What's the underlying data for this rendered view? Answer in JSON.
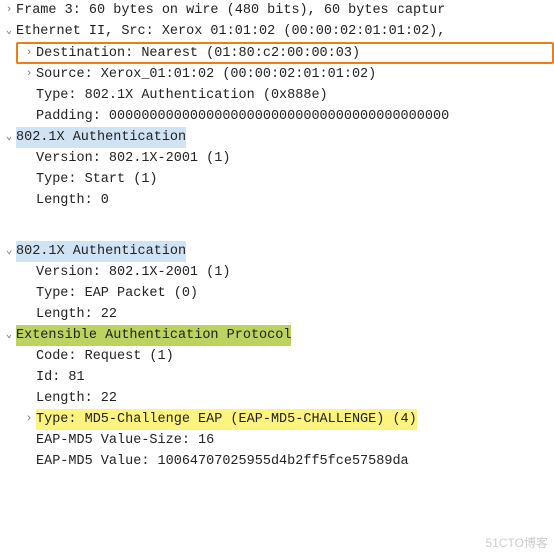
{
  "top": {
    "frame": "Frame 3: 60 bytes on wire (480 bits), 60 bytes captur",
    "eth": "Ethernet II, Src: Xerox 01:01:02 (00:00:02:01:01:02),",
    "dst": "Destination: Nearest (01:80:c2:00:00:03)",
    "src": "Source: Xerox_01:01:02 (00:00:02:01:01:02)",
    "type": "Type: 802.1X Authentication (0x888e)",
    "pad": "Padding: 000000000000000000000000000000000000000000",
    "auth": "802.1X Authentication",
    "ver": "Version: 802.1X-2001 (1)",
    "atype": "Type: Start (1)",
    "len": "Length: 0"
  },
  "bottom": {
    "auth": "802.1X Authentication",
    "ver": "Version: 802.1X-2001 (1)",
    "atype": "Type: EAP Packet (0)",
    "len": "Length: 22",
    "eap": "Extensible Authentication Protocol",
    "code": "Code: Request (1)",
    "id": "Id: 81",
    "elen": "Length: 22",
    "etype": "Type: MD5-Challenge EAP (EAP-MD5-CHALLENGE) (4)",
    "md5size": "EAP-MD5 Value-Size: 16",
    "md5val": "EAP-MD5 Value: 10064707025955d4b2ff5fce57589da"
  },
  "watermark": "51CTO博客"
}
